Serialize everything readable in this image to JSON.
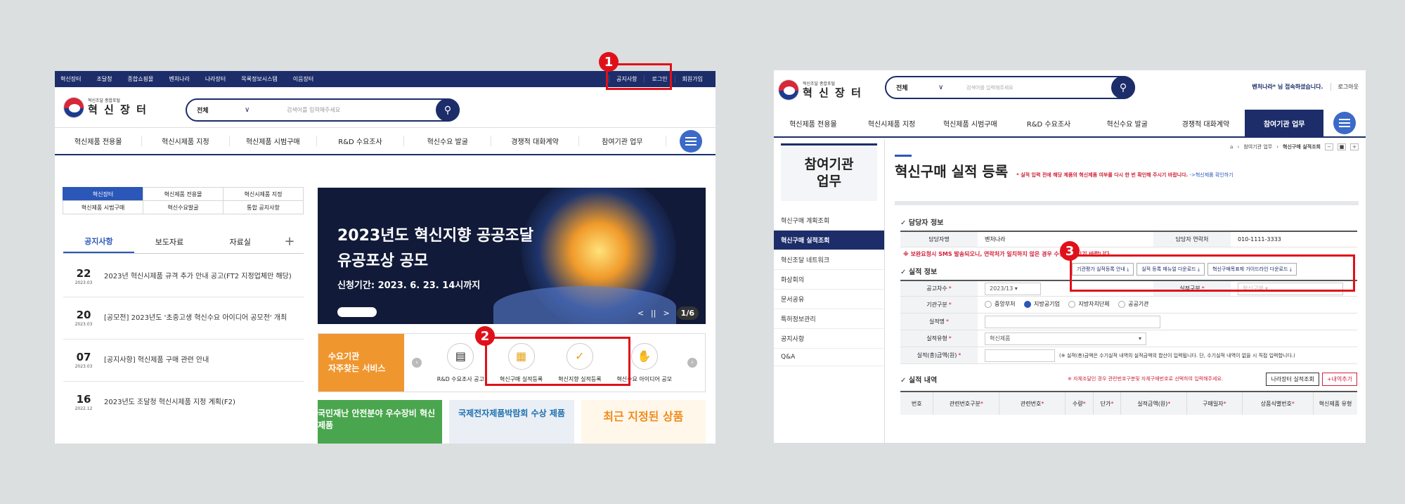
{
  "left": {
    "topbar": {
      "items": [
        "혁신장터",
        "조달청",
        "종합쇼핑몰",
        "벤처나라",
        "나라장터",
        "목록정보시스템",
        "이음장터"
      ],
      "right": [
        "공지사항",
        "로그인",
        "회원가입"
      ]
    },
    "logo": {
      "sub": "혁신조달 종합포털",
      "main": "혁 신 장 터"
    },
    "search": {
      "select": "전체",
      "placeholder": "검색어를 입력해주세요"
    },
    "nav": [
      "혁신제품 전용몰",
      "혁신시제품 지정",
      "혁신제품 시범구매",
      "R&D 수요조사",
      "혁신수요 발굴",
      "경쟁적 대화계약",
      "참여기관 업무"
    ],
    "quick_tabs": [
      [
        "혁신장터",
        "혁신제품 전용몰",
        "혁신시제품 지정"
      ],
      [
        "혁신제품 시범구매",
        "혁신수요발굴",
        "통합 공지사항"
      ]
    ],
    "news_tabs": [
      "공지사항",
      "보도자료",
      "자료실"
    ],
    "news": [
      {
        "day": "22",
        "ym": "2023.03",
        "title": "2023년 혁신시제품 규격 추가 안내 공고(FT2 지정업체만 해당)"
      },
      {
        "day": "20",
        "ym": "2023.03",
        "title": "[공모전] 2023년도 '초중고생 혁신수요 아이디어 공모전' 개최"
      },
      {
        "day": "07",
        "ym": "2023.03",
        "title": "[공지사항] 혁신제품 구매 관련 안내"
      },
      {
        "day": "16",
        "ym": "2022.12",
        "title": "2023년도 조달청 혁신시제품 지정 계획(F2)"
      }
    ],
    "banner": {
      "line1": "2023년도 혁신지향 공공조달",
      "line2": "유공포상 공모",
      "line3": "신청기간: 2023. 6. 23. 14시까지",
      "page": "1/6"
    },
    "service": {
      "label": "수요기관\n자주찾는 서비스",
      "items": [
        "R&D 수요조사 공고",
        "혁신구매 실적등록",
        "혁신지향 실적등록",
        "혁신수요 아이디어 공모"
      ]
    },
    "cards": [
      "국민재난 안전분야 우수장비 혁신제품",
      "국제전자제품박람회 수상 제품",
      "최근 지정된 상품"
    ]
  },
  "right": {
    "logo": {
      "sub": "혁신조달 종합포털",
      "main": "혁 신 장 터"
    },
    "search": {
      "select": "전체",
      "placeholder": "검색어를 입력해주세요"
    },
    "welcome_user": "벤처나라* 님 접속하셨습니다.",
    "logout": "로그아웃",
    "nav": [
      "혁신제품 전용몰",
      "혁신시제품 지정",
      "혁신제품 시범구매",
      "R&D 수요조사",
      "혁신수요 발굴",
      "경쟁적 대화계약",
      "참여기관 업무"
    ],
    "side_title": "참여기관\n업무",
    "side_items": [
      "혁신구매 계획조회",
      "혁신구매 실적조회",
      "혁신조달 네트워크",
      "화상회의",
      "문서공유",
      "특허정보관리",
      "공지사항",
      "Q&A"
    ],
    "crumb": [
      "참여기관 업무",
      "혁신구매 실적조회"
    ],
    "crumb_controls": [
      "−",
      "■",
      "+"
    ],
    "page_title": "혁신구매 실적 등록",
    "title_note": "* 실적 입력 전에 해당 제품의 혁신제품 여부를 다시 한 번 확인해 주시기 바랍니다.",
    "title_link": "->혁신제품 확인하기",
    "contact_section": "담당자 정보",
    "contact": {
      "k1": "담당자명",
      "v1": "벤처나라",
      "k2": "담당자 연락처",
      "v2": "010-1111-3333"
    },
    "warning": "※ 보완요청시 SMS 발송되오니, 연락처가 일치하지 않은 경우 수정해 주시기 바랍니다.",
    "perf_section": "실적 정보",
    "downloads": [
      "기관평가 실적등록 안내",
      "실적 등록 매뉴얼 다운로드",
      "혁신구매목표제 가이드라인 다운로드"
    ],
    "rows": [
      {
        "k": "공고차수",
        "v": "2023/13",
        "k2": "실적구분",
        "v2": "혁신구매"
      },
      {
        "k": "기관구분",
        "radios": [
          "중앙부처",
          "지방공기업",
          "지방자치단체",
          "공공기관"
        ]
      },
      {
        "k": "실적명",
        "v": ""
      },
      {
        "k": "실적유형",
        "v": "혁신제품"
      },
      {
        "k": "실적(총)금액(원)",
        "v": "",
        "note": "(※ 실적(총)금액은 수기실적 내역의 실적금액의 합산이 입력됩니다. 단, 수기실적 내역이 없을 시 직접 입력합니다.)"
      }
    ],
    "list_section": "실적 내역",
    "list_note": "※ 자체조달인 경우 관련번호구분및 자체구매번호로 선택하여 입력해주세요.",
    "list_buttons": [
      "나라장터 실적조회",
      "+내역추가"
    ],
    "list_headers": [
      "번호",
      "관련번호구분",
      "관련번호",
      "수량",
      "단가",
      "실적금액(원)",
      "구매일자",
      "상품식별번호",
      "혁신제품 유형"
    ]
  },
  "annotations": [
    "1",
    "2",
    "3"
  ]
}
